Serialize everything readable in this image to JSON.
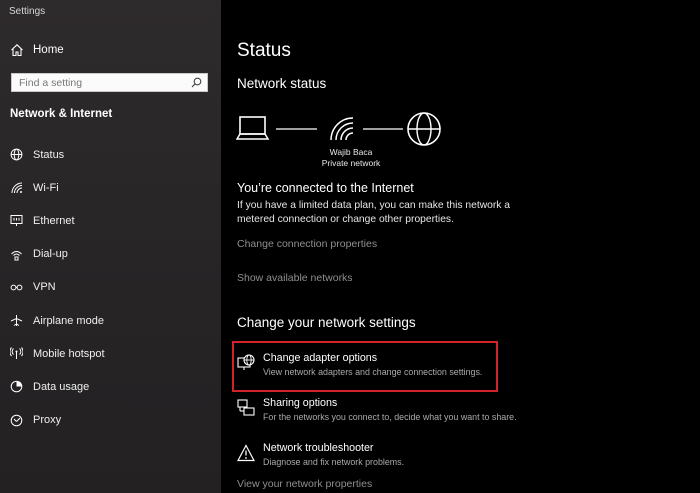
{
  "window": {
    "title": "Settings"
  },
  "sidebar": {
    "home_label": "Home",
    "search_placeholder": "Find a setting",
    "section_title": "Network & Internet",
    "items": [
      {
        "label": "Status",
        "icon": "status-icon"
      },
      {
        "label": "Wi-Fi",
        "icon": "wifi-icon"
      },
      {
        "label": "Ethernet",
        "icon": "ethernet-icon"
      },
      {
        "label": "Dial-up",
        "icon": "dialup-icon"
      },
      {
        "label": "VPN",
        "icon": "vpn-icon"
      },
      {
        "label": "Airplane mode",
        "icon": "airplane-icon"
      },
      {
        "label": "Mobile hotspot",
        "icon": "hotspot-icon"
      },
      {
        "label": "Data usage",
        "icon": "data-usage-icon"
      },
      {
        "label": "Proxy",
        "icon": "proxy-icon"
      }
    ]
  },
  "main": {
    "title": "Status",
    "network_status_heading": "Network status",
    "network_name": "Wajib Baca",
    "network_type": "Private network",
    "connected_title": "You’re connected to the Internet",
    "connected_desc": "If you have a limited data plan, you can make this network a metered connection or change other properties.",
    "change_connection_link": "Change connection properties",
    "show_networks_link": "Show available networks",
    "change_settings_heading": "Change your network settings",
    "options": [
      {
        "title": "Change adapter options",
        "desc": "View network adapters and change connection settings.",
        "icon": "adapter-icon"
      },
      {
        "title": "Sharing options",
        "desc": "For the networks you connect to, decide what you want to share.",
        "icon": "sharing-icon"
      },
      {
        "title": "Network troubleshooter",
        "desc": "Diagnose and fix network problems.",
        "icon": "warning-icon"
      }
    ],
    "view_properties_link": "View your network properties"
  },
  "colors": {
    "sidebar_bg": "#2a2829",
    "main_bg": "#000000",
    "highlight": "#d2222a",
    "link": "#8f8f8f"
  }
}
